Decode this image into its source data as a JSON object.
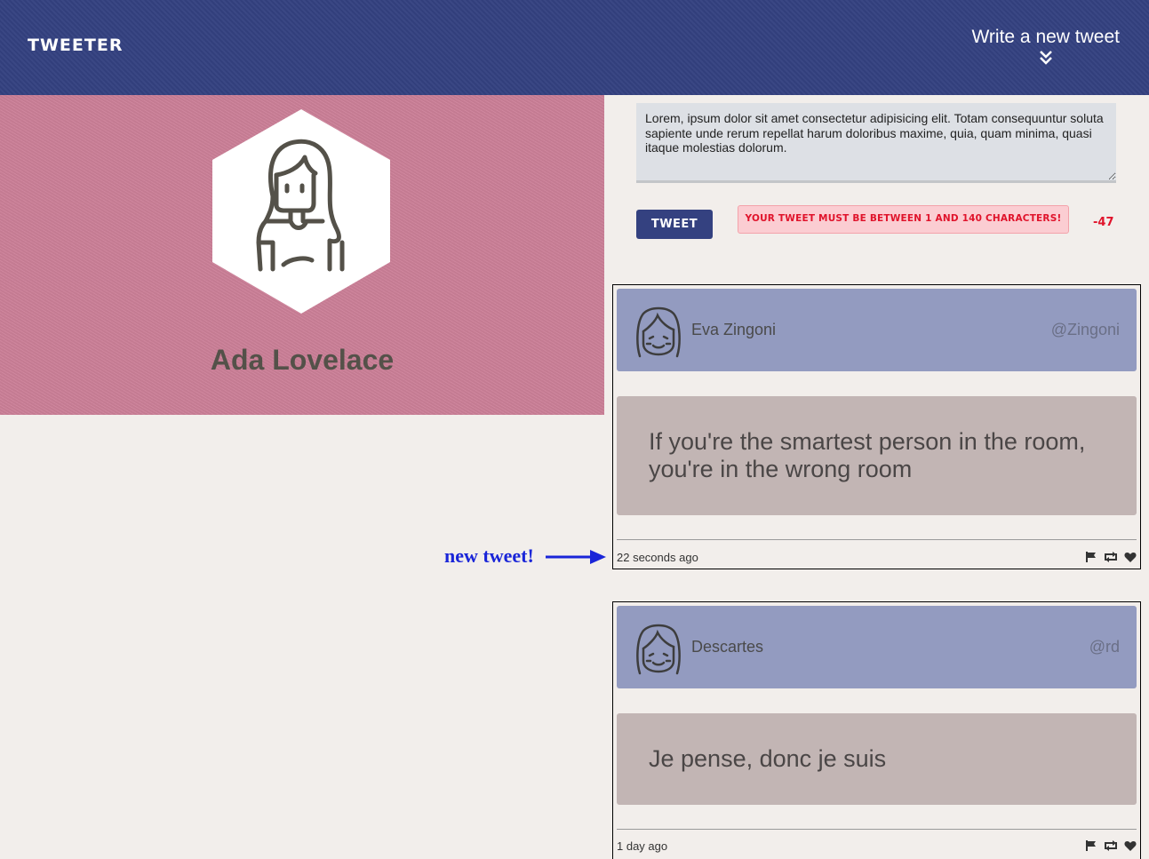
{
  "nav": {
    "brand": "TWEETER",
    "compose_label": "Write a new tweet"
  },
  "profile": {
    "name": "Ada Lovelace"
  },
  "composer": {
    "text": "Lorem, ipsum dolor sit amet consectetur adipisicing elit. Totam consequuntur soluta sapiente unde rerum repellat harum doloribus maxime, quia, quam minima, quasi itaque molestias dolorum.",
    "button_label": "Tweet",
    "error_message": "Your tweet must be between 1 and 140 characters!",
    "counter": "-47"
  },
  "annotation": {
    "label": "new tweet!"
  },
  "tweets": [
    {
      "name": "Eva Zingoni",
      "handle": "@Zingoni",
      "text": "If you're the smartest person in the room, you're in the wrong room",
      "time": "22 seconds ago"
    },
    {
      "name": "Descartes",
      "handle": "@rd",
      "text": "Je pense, donc je suis",
      "time": "1 day ago"
    }
  ],
  "icons": {
    "flag": "flag-icon",
    "retweet": "retweet-icon",
    "like": "heart-icon",
    "compose_chevron": "double-chevron-down-icon"
  },
  "colors": {
    "nav_bg": "#344180",
    "profile_bg": "#cc8098",
    "tweet_header_bg": "#939bc0",
    "tweet_body_bg": "#c2b5b4",
    "error_text": "#e0132b",
    "annotation": "#1a25d8"
  }
}
